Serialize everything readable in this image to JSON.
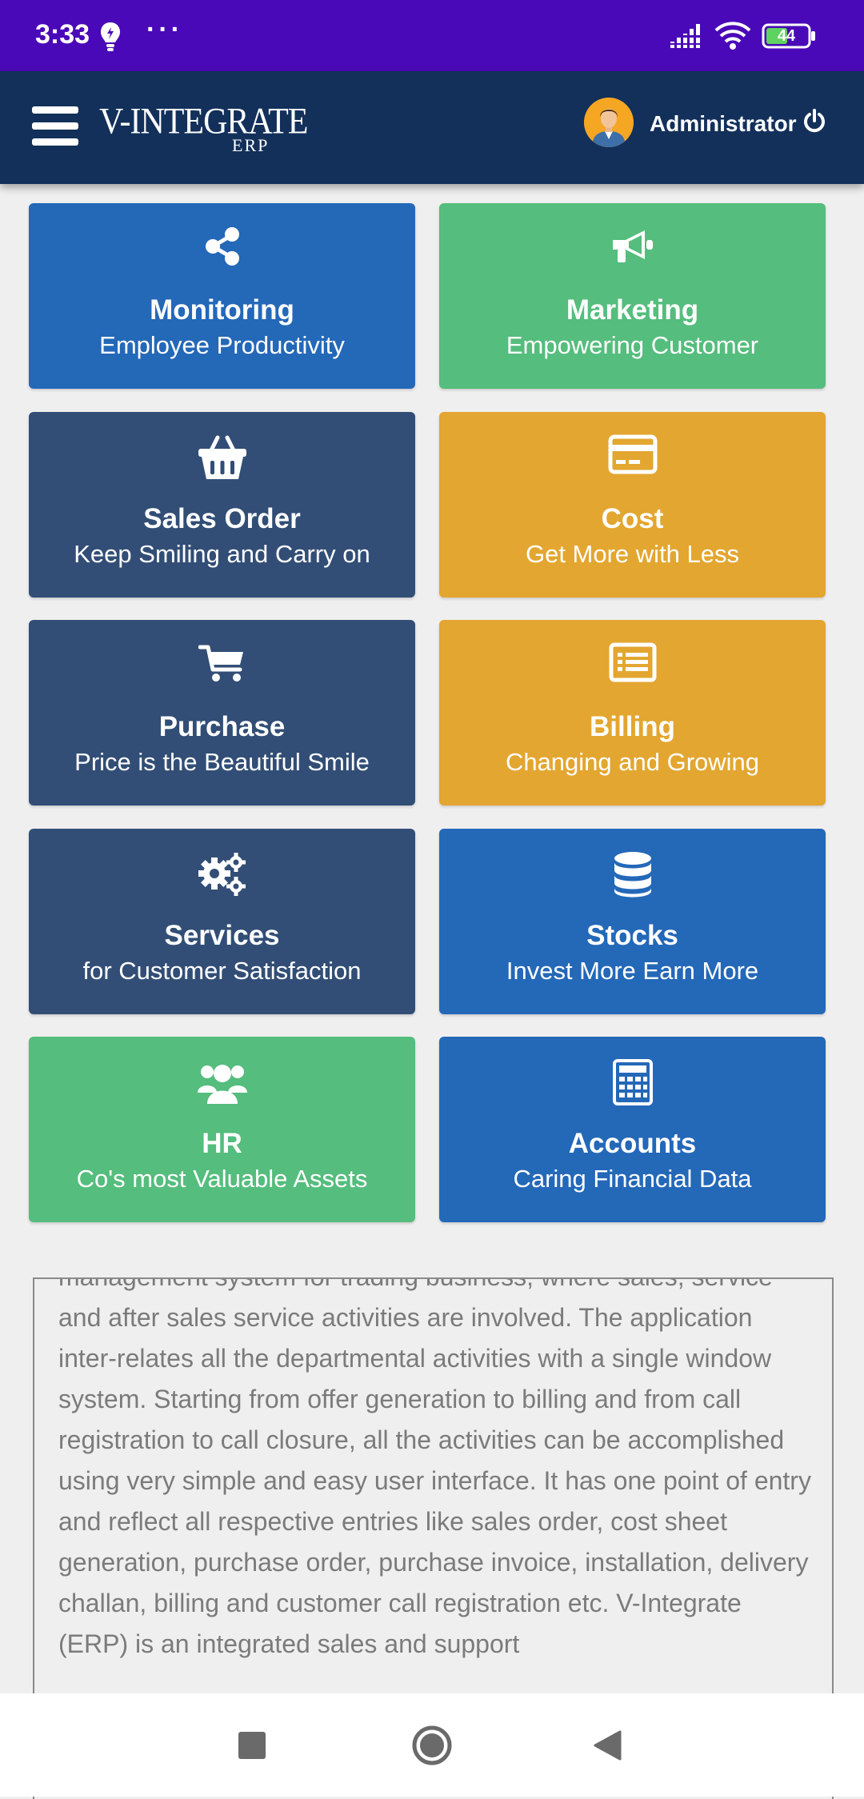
{
  "status_bar": {
    "time": "3:33",
    "dots": "···",
    "battery": "44",
    "icons": [
      "lightbulb-icon",
      "signal-icon",
      "wifi-icon",
      "battery-icon"
    ]
  },
  "header": {
    "logo_main": "V-INTEGRATE",
    "logo_sub": "ERP",
    "user_name": "Administrator",
    "icons": [
      "menu-icon",
      "avatar",
      "power-icon"
    ],
    "background": "#12305a"
  },
  "tiles": [
    {
      "title": "Monitoring",
      "subtitle": "Employee Productivity",
      "icon": "share-icon",
      "color": "#2468b8"
    },
    {
      "title": "Marketing",
      "subtitle": "Empowering Customer",
      "icon": "megaphone-icon",
      "color": "#55bd7d"
    },
    {
      "title": "Sales Order",
      "subtitle": "Keep Smiling and Carry on",
      "icon": "basket-icon",
      "color": "#324e76"
    },
    {
      "title": "Cost",
      "subtitle": "Get More with Less",
      "icon": "credit-card-icon",
      "color": "#e3a630"
    },
    {
      "title": "Purchase",
      "subtitle": "Price is the Beautiful Smile",
      "icon": "cart-icon",
      "color": "#324e76"
    },
    {
      "title": "Billing",
      "subtitle": "Changing and Growing",
      "icon": "list-icon",
      "color": "#e3a630"
    },
    {
      "title": "Services",
      "subtitle": "for Customer Satisfaction",
      "icon": "gears-icon",
      "color": "#324e76"
    },
    {
      "title": "Stocks",
      "subtitle": "Invest More Earn More",
      "icon": "database-icon",
      "color": "#2468b8"
    },
    {
      "title": "HR",
      "subtitle": "Co's most Valuable Assets",
      "icon": "users-icon",
      "color": "#55bd7d"
    },
    {
      "title": "Accounts",
      "subtitle": "Caring Financial Data",
      "icon": "calculator-icon",
      "color": "#2468b8"
    }
  ],
  "description": "management system for trading business, where sales, service and after sales service activities are involved. The application inter-relates all the departmental activities with a single window system. Starting from offer generation to billing and from call registration to call closure, all the activities can be accomplished using very simple and easy user interface. It has one point of entry and reflect all respective entries like sales order, cost sheet generation, purchase order, purchase invoice, installation, delivery challan, billing and customer call registration etc. V-Integrate (ERP) is an integrated sales and support",
  "nav_bar": {
    "buttons": [
      "recents-button",
      "home-button",
      "back-button"
    ]
  }
}
